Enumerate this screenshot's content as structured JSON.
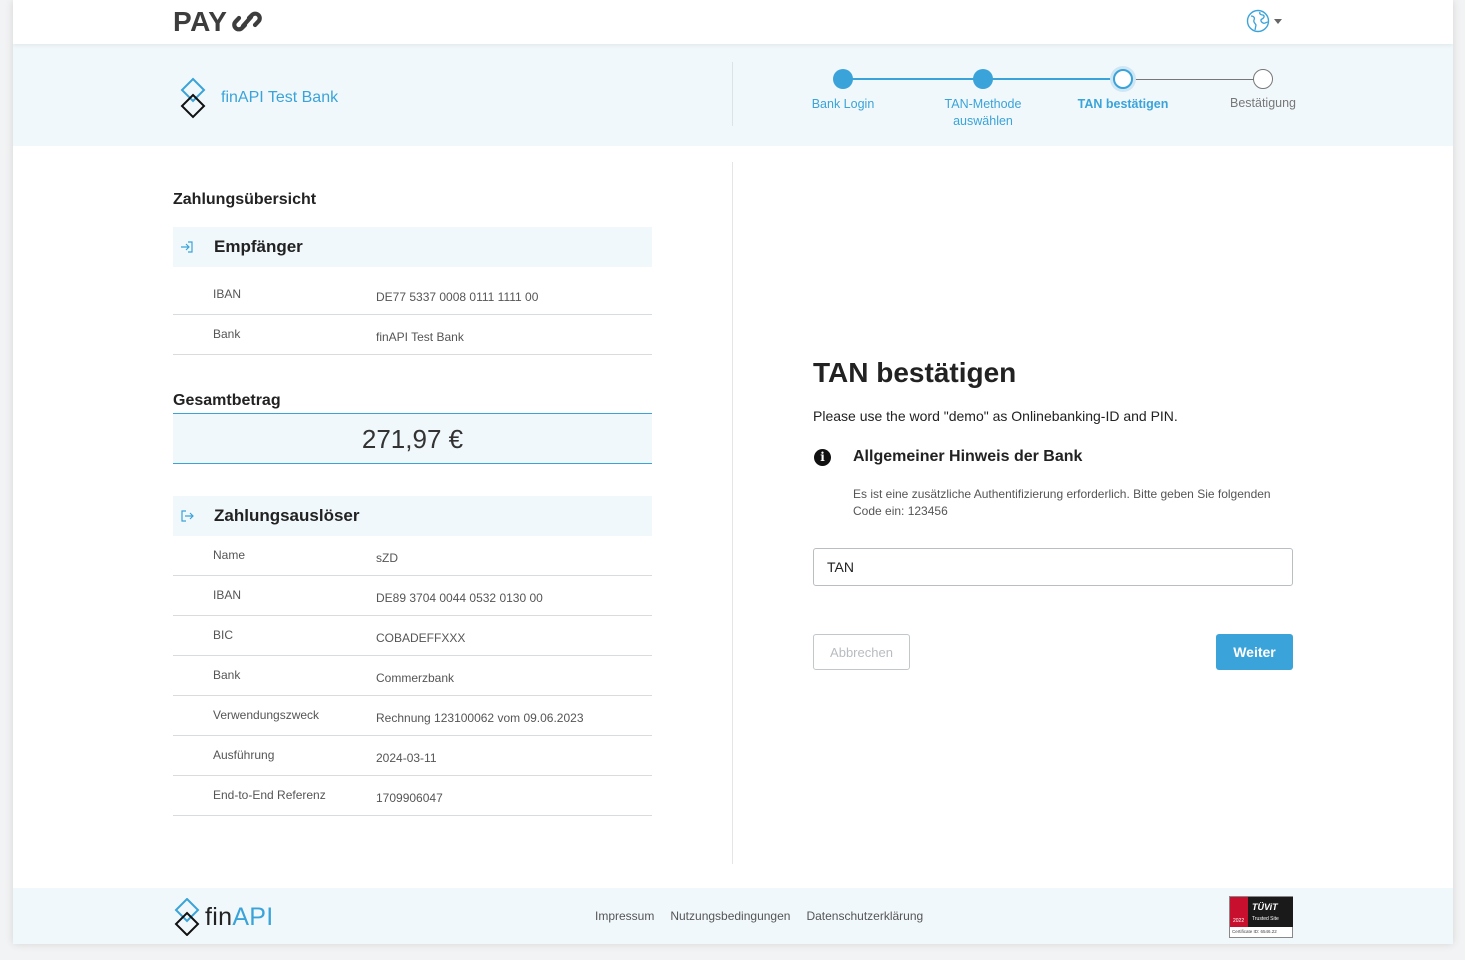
{
  "header": {
    "logo_text": "PAY",
    "language_icon": "globe-icon"
  },
  "bank": {
    "name": "finAPI Test Bank",
    "logo_icon": "bank-diamond-logo-icon"
  },
  "stepper": {
    "steps": [
      {
        "label": "Bank Login",
        "state": "done"
      },
      {
        "label": "TAN-Methode auswählen",
        "state": "done"
      },
      {
        "label": "TAN bestätigen",
        "state": "active"
      },
      {
        "label": "Bestätigung",
        "state": "todo"
      }
    ],
    "colors": {
      "accent": "#3aa3d9",
      "todo": "#777777"
    }
  },
  "summary": {
    "title": "Zahlungsübersicht",
    "recipient": {
      "title": "Empfänger",
      "icon": "sign-in-icon",
      "rows": [
        {
          "key": "IBAN",
          "value": "DE77 5337 0008 0111 1111 00"
        },
        {
          "key": "Bank",
          "value": "finAPI Test Bank"
        }
      ]
    },
    "total": {
      "title": "Gesamtbetrag",
      "amount": "271,97 €"
    },
    "payer": {
      "title": "Zahlungsauslöser",
      "icon": "sign-out-icon",
      "rows": [
        {
          "key": "Name",
          "value": "sZD"
        },
        {
          "key": "IBAN",
          "value": "DE89 3704 0044 0532 0130 00"
        },
        {
          "key": "BIC",
          "value": "COBADEFFXXX"
        },
        {
          "key": "Bank",
          "value": "Commerzbank"
        },
        {
          "key": "Verwendungszweck",
          "value": "Rechnung 123100062 vom 09.06.2023"
        },
        {
          "key": "Ausführung",
          "value": "2024-03-11"
        },
        {
          "key": "End-to-End Referenz",
          "value": "1709906047"
        }
      ]
    }
  },
  "tan": {
    "title": "TAN bestätigen",
    "instruction": "Please use the word \"demo\" as Onlinebanking-ID and PIN.",
    "notice_icon": "info-icon",
    "notice_title": "Allgemeiner Hinweis der Bank",
    "notice_text": "Es ist eine zusätzliche Authentifizierung erforderlich. Bitte geben Sie folgenden Code ein: 123456",
    "input_placeholder": "TAN",
    "input_value": "",
    "cancel_label": "Abbrechen",
    "next_label": "Weiter"
  },
  "footer": {
    "logo_fin": "fin",
    "logo_api": "API",
    "links": [
      "Impressum",
      "Nutzungsbedingungen",
      "Datenschutzerklärung"
    ],
    "badge": {
      "brand": "TÜViT",
      "subtitle": "Trusted Site",
      "year": "2022",
      "certificate": "Certificate ID: 6546.22"
    }
  }
}
